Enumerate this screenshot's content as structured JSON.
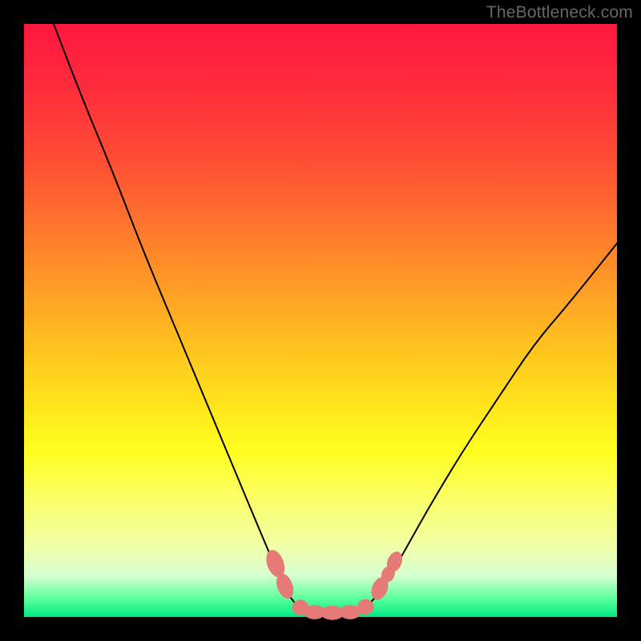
{
  "watermark": "TheBottleneck.com",
  "chart_data": {
    "type": "line",
    "title": "",
    "xlabel": "",
    "ylabel": "",
    "xlim": [
      0,
      100
    ],
    "ylim": [
      0,
      100
    ],
    "grid": false,
    "legend": false,
    "series": [
      {
        "name": "left-curve",
        "x": [
          5,
          10,
          15,
          20,
          25,
          30,
          35,
          40,
          43,
          45,
          47
        ],
        "y": [
          100,
          87,
          75,
          62,
          50,
          38,
          26,
          14,
          7,
          3,
          1
        ],
        "color": "#000000"
      },
      {
        "name": "right-curve",
        "x": [
          57,
          60,
          63,
          68,
          74,
          80,
          86,
          92,
          100
        ],
        "y": [
          1,
          4,
          9,
          18,
          28,
          37,
          46,
          53,
          63
        ],
        "color": "#000000"
      },
      {
        "name": "valley-floor",
        "x": [
          47,
          49,
          51,
          53,
          55,
          57
        ],
        "y": [
          1,
          0.5,
          0.5,
          0.5,
          0.5,
          1
        ],
        "color": "#000000"
      }
    ],
    "markers": [
      {
        "cx": 42.4,
        "cy": 9.0,
        "rx": 1.4,
        "ry": 2.4,
        "angle": -20
      },
      {
        "cx": 44.0,
        "cy": 5.2,
        "rx": 1.3,
        "ry": 2.2,
        "angle": -20
      },
      {
        "cx": 46.6,
        "cy": 1.6,
        "rx": 1.4,
        "ry": 1.3,
        "angle": 0
      },
      {
        "cx": 49.0,
        "cy": 0.8,
        "rx": 1.8,
        "ry": 1.2,
        "angle": 0
      },
      {
        "cx": 52.0,
        "cy": 0.7,
        "rx": 2.0,
        "ry": 1.2,
        "angle": 0
      },
      {
        "cx": 55.0,
        "cy": 0.8,
        "rx": 1.8,
        "ry": 1.2,
        "angle": 0
      },
      {
        "cx": 57.6,
        "cy": 1.7,
        "rx": 1.4,
        "ry": 1.3,
        "angle": 0
      },
      {
        "cx": 60.0,
        "cy": 4.8,
        "rx": 1.3,
        "ry": 2.0,
        "angle": 22
      },
      {
        "cx": 61.4,
        "cy": 7.2,
        "rx": 1.1,
        "ry": 1.4,
        "angle": 22
      },
      {
        "cx": 62.5,
        "cy": 9.3,
        "rx": 1.2,
        "ry": 1.8,
        "angle": 22
      }
    ],
    "marker_color": "#e67a76"
  }
}
